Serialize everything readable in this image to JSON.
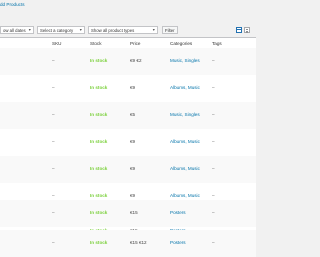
{
  "top_link": "dd Products",
  "filters": {
    "dates": "ow all dates",
    "category": "Select a category",
    "product_types": "Show all product types",
    "filter_button": "Filter"
  },
  "columns": [
    "SKU",
    "Stock",
    "Price",
    "Categories",
    "Tags"
  ],
  "rows": [
    {
      "sku": "–",
      "stock": "In stock",
      "price": "€9 €2",
      "categories": "Music, Singles",
      "tags": "–"
    },
    {
      "sku": "–",
      "stock": "In stock",
      "price": "€9",
      "categories": "Albums, Music",
      "tags": "–"
    },
    {
      "sku": "–",
      "stock": "In stock",
      "price": "€5",
      "categories": "Music, Singles",
      "tags": "–"
    },
    {
      "sku": "–",
      "stock": "In stock",
      "price": "€9",
      "categories": "Albums, Music",
      "tags": "–"
    },
    {
      "sku": "–",
      "stock": "In stock",
      "price": "€9",
      "categories": "Albums, Music",
      "tags": "–"
    },
    {
      "sku": "–",
      "stock": "In stock",
      "price": "€9",
      "categories": "Albums, Music",
      "tags": "–"
    },
    {
      "sku": "–",
      "stock": "In stock",
      "price": "€15",
      "categories": "Posters",
      "tags": "–"
    },
    {
      "sku": "–",
      "stock": "In stock",
      "price": "€15",
      "categories": "Posters",
      "tags": "–"
    },
    {
      "sku": "–",
      "stock": "In stock",
      "price": "€15 €12",
      "categories": "Posters",
      "tags": "–"
    }
  ],
  "colors": {
    "accent": "#0073aa",
    "in_stock": "#7ad03a"
  },
  "icons": [
    "chevron-down-icon",
    "list-view-icon",
    "excerpt-view-icon"
  ]
}
